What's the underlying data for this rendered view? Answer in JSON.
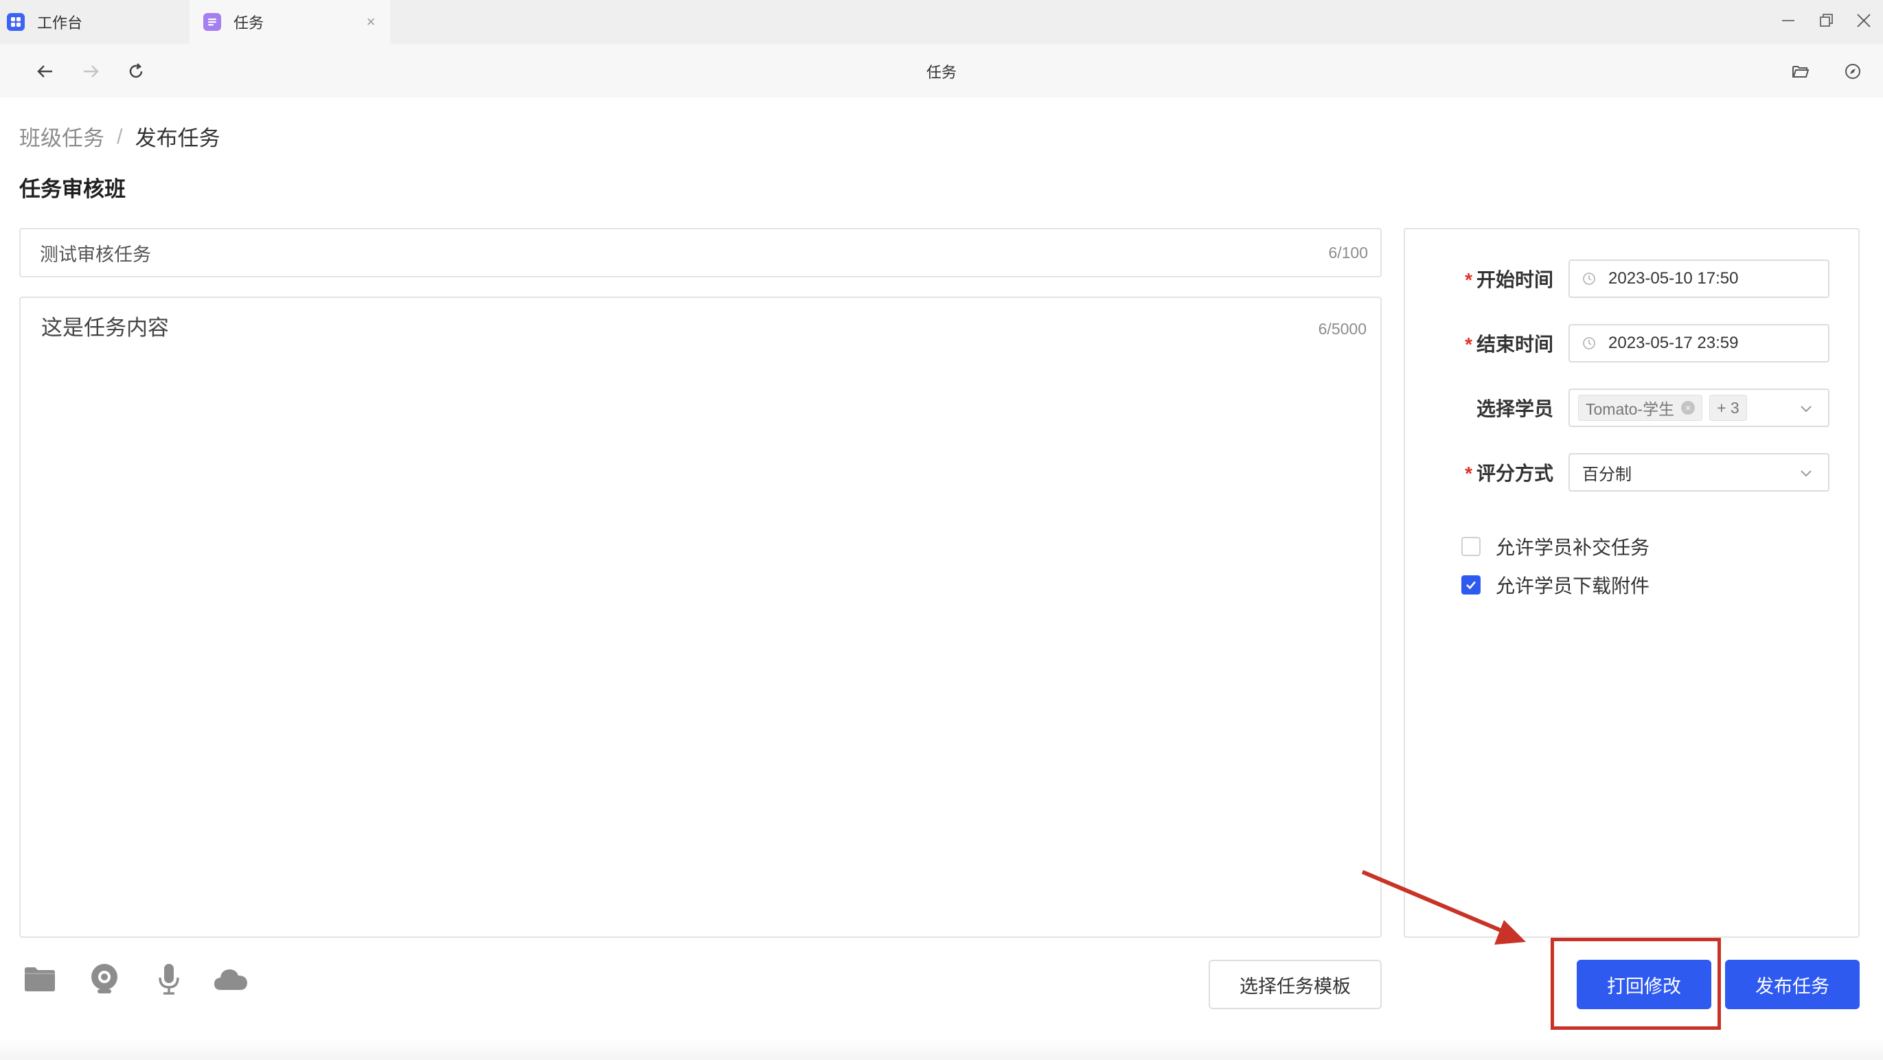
{
  "tabs": [
    {
      "label": "工作台",
      "icon": "grid-app-icon",
      "active": false
    },
    {
      "label": "任务",
      "icon": "task-app-icon",
      "active": true
    }
  ],
  "window_controls": [
    "minimize-icon",
    "restore-icon",
    "close-icon"
  ],
  "nav": {
    "title": "任务",
    "buttons": [
      "back-arrow-icon",
      "forward-arrow-icon",
      "refresh-icon"
    ],
    "right_icons": [
      "folder-open-icon",
      "compass-icon"
    ]
  },
  "breadcrumb": {
    "parent": "班级任务",
    "separator": "/",
    "current": "发布任务"
  },
  "class_title": "任务审核班",
  "task_title": {
    "value": "测试审核任务",
    "counter": "6/100"
  },
  "task_content": {
    "value": "这是任务内容",
    "counter": "6/5000"
  },
  "attachment_tools": [
    "folder-icon",
    "camera-icon",
    "microphone-icon",
    "cloud-icon"
  ],
  "buttons": {
    "select_template": "选择任务模板",
    "reject": "打回修改",
    "publish": "发布任务"
  },
  "settings": {
    "start_time": {
      "label": "开始时间",
      "required": true,
      "value": "2023-05-10 17:50"
    },
    "end_time": {
      "label": "结束时间",
      "required": true,
      "value": "2023-05-17 23:59"
    },
    "students": {
      "label": "选择学员",
      "required": false,
      "tag": "Tomato-学生",
      "more": "+ 3"
    },
    "grading": {
      "label": "评分方式",
      "required": true,
      "value": "百分制"
    },
    "allow_late": {
      "label": "允许学员补交任务",
      "checked": false
    },
    "allow_download": {
      "label": "允许学员下载附件",
      "checked": true
    }
  },
  "colors": {
    "primary": "#2e5af0",
    "required": "#e2322a",
    "annotation": "#c93327"
  }
}
